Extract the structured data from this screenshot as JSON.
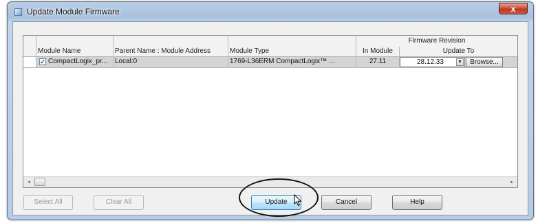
{
  "window": {
    "title": "Update Module Firmware",
    "close_glyph": "x"
  },
  "table": {
    "group_header": "Firmware Revision",
    "columns": {
      "module_name": "Module Name",
      "parent": "Parent Name : Module Address",
      "module_type": "Module Type",
      "in_module": "In Module",
      "update_to": "Update To"
    },
    "rows": [
      {
        "checked": true,
        "check_glyph": "✓",
        "module_name": "CompactLogix_pr...",
        "parent": "Local:0",
        "module_type": "1769-L36ERM CompactLogix™ ...",
        "in_module": "27.11",
        "update_to": "28.12.33",
        "browse_label": "Browse..."
      }
    ]
  },
  "scrollbar": {
    "left_glyph": "◂",
    "right_glyph": "▸"
  },
  "buttons": {
    "select_all": "Select All",
    "clear_all": "Clear All",
    "update": "Update",
    "cancel": "Cancel",
    "help": "Help"
  },
  "icons": {
    "close": "close-icon",
    "dropdown": "chevron-down-icon",
    "cursor": "mouse-pointer-icon"
  }
}
